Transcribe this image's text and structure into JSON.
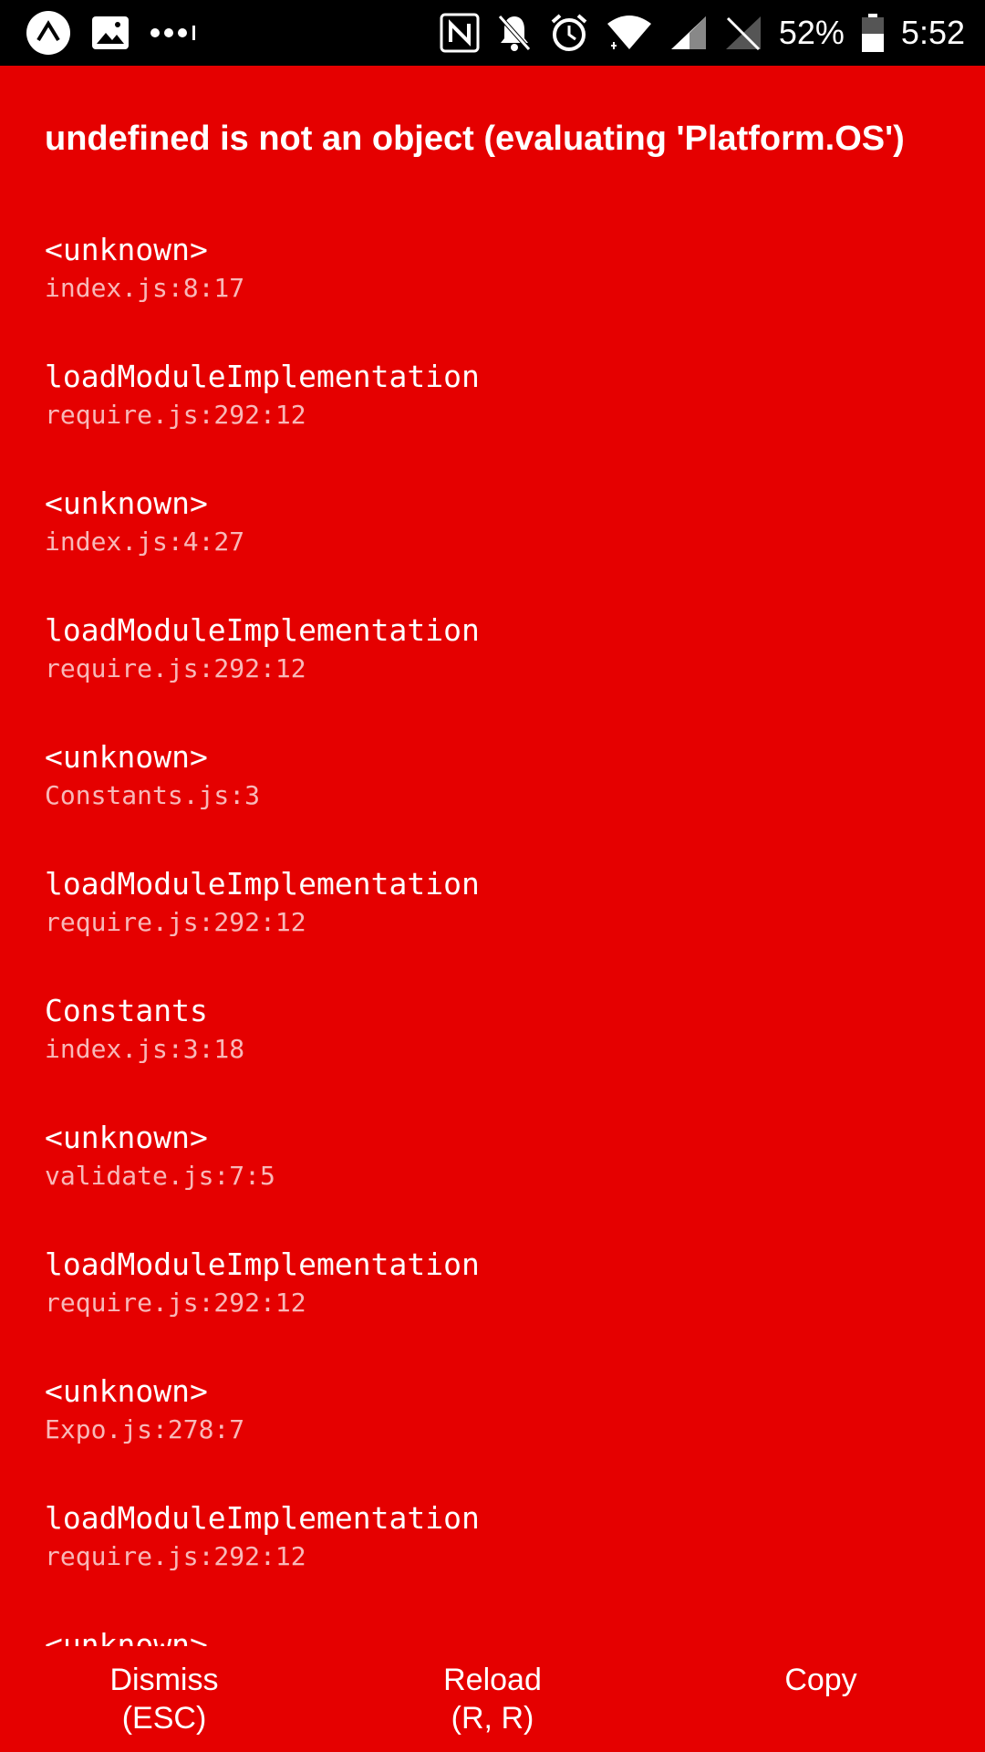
{
  "status_bar": {
    "battery": "52%",
    "time": "5:52",
    "icons": [
      "expo-icon",
      "image-icon",
      "more-dots-icon",
      "nfc-icon",
      "notifications-off-icon",
      "alarm-icon",
      "wifi-icon",
      "signal-icon",
      "signal-off-icon",
      "battery-icon"
    ]
  },
  "error": {
    "message": "undefined is not an object (evaluating 'Platform.OS')",
    "stack": [
      {
        "method": "<unknown>",
        "file": "index.js:8:17"
      },
      {
        "method": "loadModuleImplementation",
        "file": "require.js:292:12"
      },
      {
        "method": "<unknown>",
        "file": "index.js:4:27"
      },
      {
        "method": "loadModuleImplementation",
        "file": "require.js:292:12"
      },
      {
        "method": "<unknown>",
        "file": "Constants.js:3"
      },
      {
        "method": "loadModuleImplementation",
        "file": "require.js:292:12"
      },
      {
        "method": "Constants",
        "file": "index.js:3:18"
      },
      {
        "method": "<unknown>",
        "file": "validate.js:7:5"
      },
      {
        "method": "loadModuleImplementation",
        "file": "require.js:292:12"
      },
      {
        "method": "<unknown>",
        "file": "Expo.js:278:7"
      },
      {
        "method": "loadModuleImplementation",
        "file": "require.js:292:12"
      },
      {
        "method": "<unknown>",
        "file": ""
      }
    ]
  },
  "buttons": {
    "dismiss": {
      "line1": "Dismiss",
      "line2": "(ESC)"
    },
    "reload": {
      "line1": "Reload",
      "line2": "(R, R)"
    },
    "copy": {
      "line1": "Copy"
    }
  },
  "colors": {
    "background": "#e50000",
    "status_bar": "#000000",
    "text": "#ffffff"
  }
}
